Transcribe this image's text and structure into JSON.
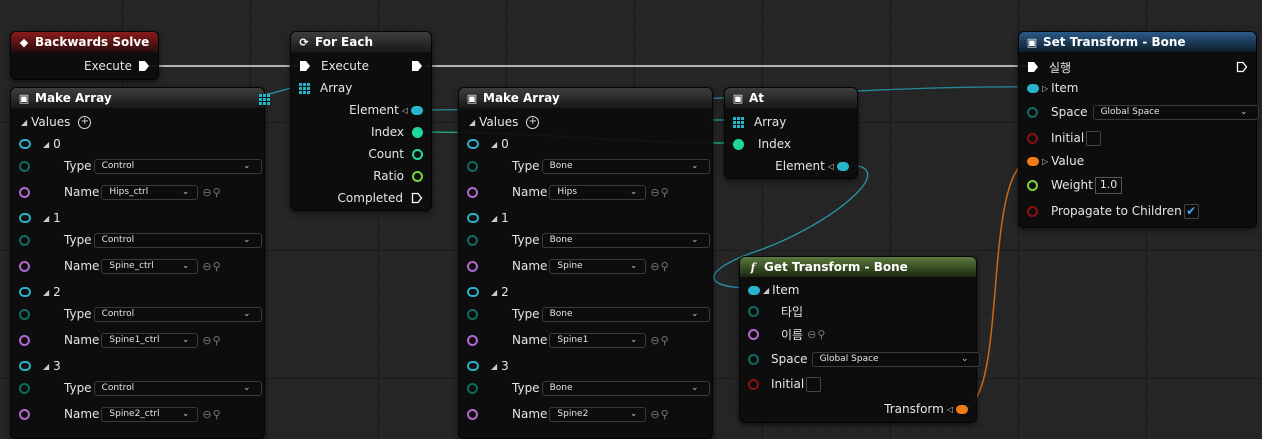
{
  "colors": {
    "exec": "#f0f0f0",
    "struct_select": "#27b5cc",
    "enum": "#0f6b60",
    "name": "#b168d2",
    "int": "#1ed8a0",
    "float": "#7ad13b",
    "bool": "#8a1111",
    "transform": "#f07a15"
  },
  "backwards_solve": {
    "title": "Backwards Solve",
    "icon": "event-diamond-icon",
    "execute_label": "Execute"
  },
  "for_each": {
    "title": "For Each",
    "icon": "loop-icon",
    "execute_in_label": "Execute",
    "array_label": "Array",
    "element_label": "Element",
    "index_label": "Index",
    "count_label": "Count",
    "ratio_label": "Ratio",
    "completed_label": "Completed"
  },
  "make_array_1": {
    "title": "Make Array",
    "values_label": "Values",
    "type_label": "Type",
    "name_label": "Name",
    "items": [
      {
        "index": "0",
        "type": "Control",
        "name": "Hips_ctrl"
      },
      {
        "index": "1",
        "type": "Control",
        "name": "Spine_ctrl"
      },
      {
        "index": "2",
        "type": "Control",
        "name": "Spine1_ctrl"
      },
      {
        "index": "3",
        "type": "Control",
        "name": "Spine2_ctrl"
      }
    ]
  },
  "make_array_2": {
    "title": "Make Array",
    "values_label": "Values",
    "type_label": "Type",
    "name_label": "Name",
    "items": [
      {
        "index": "0",
        "type": "Bone",
        "name": "Hips"
      },
      {
        "index": "1",
        "type": "Bone",
        "name": "Spine"
      },
      {
        "index": "2",
        "type": "Bone",
        "name": "Spine1"
      },
      {
        "index": "3",
        "type": "Bone",
        "name": "Spine2"
      }
    ]
  },
  "at": {
    "title": "At",
    "array_label": "Array",
    "index_label": "Index",
    "element_label": "Element"
  },
  "get_transform": {
    "title": "Get Transform - Bone",
    "icon": "function-icon",
    "item_label": "Item",
    "type_label": "타입",
    "name_label": "이름",
    "space_label": "Space",
    "space_value": "Global Space",
    "initial_label": "Initial",
    "transform_label": "Transform"
  },
  "set_transform": {
    "title": "Set Transform - Bone",
    "exec_label": "실행",
    "item_label": "Item",
    "space_label": "Space",
    "space_value": "Global Space",
    "initial_label": "Initial",
    "value_label": "Value",
    "weight_label": "Weight",
    "weight_value": "1.0",
    "propagate_label": "Propagate to Children",
    "propagate_checked": true
  }
}
